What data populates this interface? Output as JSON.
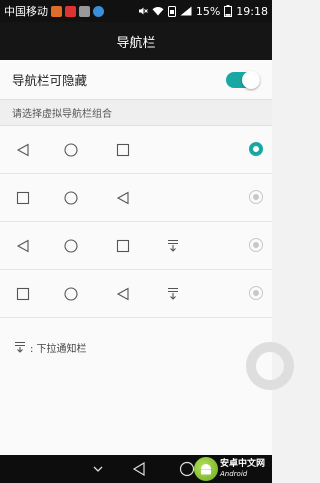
{
  "status_bar": {
    "carrier": "中国移动",
    "battery": "15%",
    "time": "19:18"
  },
  "title": "导航栏",
  "toggle": {
    "label": "导航栏可隐藏",
    "on": true
  },
  "section_header": "请选择虚拟导航栏组合",
  "options": [
    {
      "buttons": [
        "back-icon",
        "home-icon",
        "recents-icon"
      ],
      "selected": true
    },
    {
      "buttons": [
        "recents-icon",
        "home-icon",
        "back-icon"
      ],
      "selected": false
    },
    {
      "buttons": [
        "back-icon",
        "home-icon",
        "recents-icon",
        "notification-pulldown-icon"
      ],
      "selected": false
    },
    {
      "buttons": [
        "recents-icon",
        "home-icon",
        "back-icon",
        "notification-pulldown-icon"
      ],
      "selected": false
    }
  ],
  "note": ": 下拉通知栏",
  "watermark": {
    "cn": "安卓中文网",
    "en": "Android"
  },
  "colors": {
    "accent": "#19a7a4",
    "title_bar": "#151515",
    "status_bar": "#111111"
  }
}
